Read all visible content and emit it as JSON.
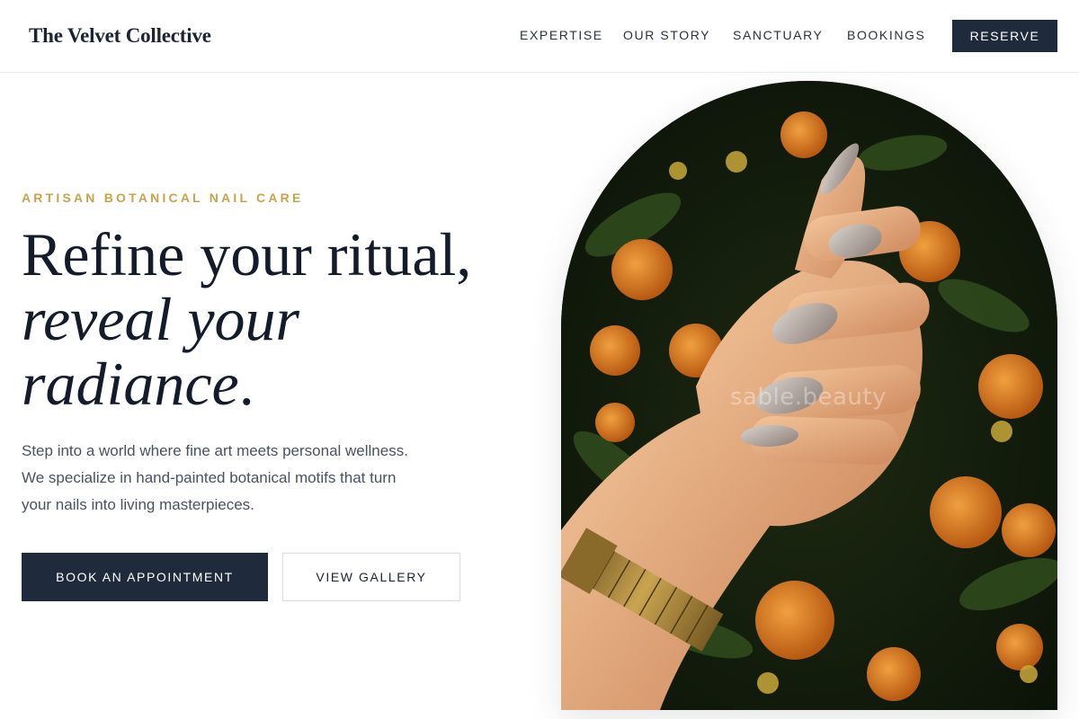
{
  "header": {
    "brand": "The Velvet Collective",
    "nav": [
      "EXPERTISE",
      "OUR STORY",
      "SANCTUARY",
      "BOOKINGS"
    ],
    "reserve_label": "RESERVE"
  },
  "hero": {
    "eyebrow": "ARTISAN BOTANICAL NAIL CARE",
    "headline_line1": "Refine your ritual,",
    "headline_line2": "reveal your",
    "headline_line3": "radiance",
    "headline_period": ".",
    "body_line1": "Step into a world where fine art meets personal wellness.",
    "body_line2": "We specialize in hand-painted botanical motifs that turn",
    "body_line3": "your nails into living masterpieces.",
    "primary_cta": "BOOK AN APPOINTMENT",
    "secondary_cta": "VIEW GALLERY"
  },
  "image": {
    "watermark": "sable.beauty"
  },
  "colors": {
    "navy": "#1f2a3c",
    "gold": "#c9a34a",
    "text": "#4a5160"
  }
}
